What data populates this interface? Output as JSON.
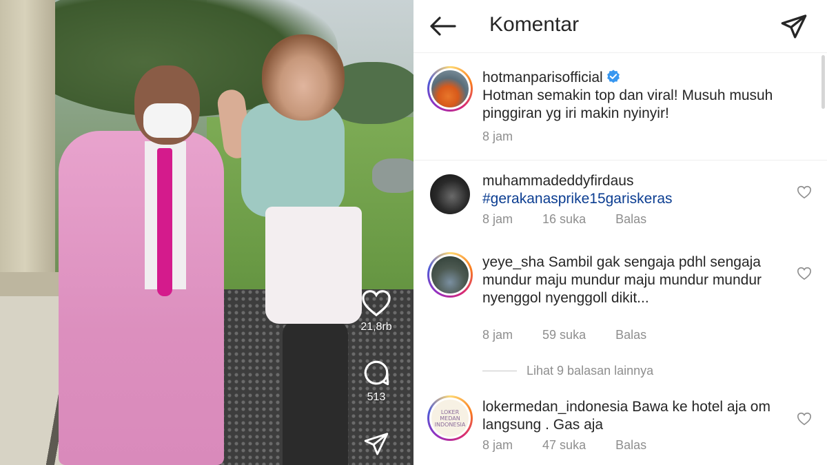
{
  "video": {
    "like_count": "21,8rb",
    "comment_count": "513"
  },
  "header": {
    "title": "Komentar"
  },
  "caption": {
    "username": "hotmanparisofficial",
    "verified": true,
    "text": "Hotman semakin top dan viral! Musuh musuh pinggiran yg iri makin nyinyir!",
    "time": "8 jam"
  },
  "comments": [
    {
      "username": "muhammadeddyfirdaus",
      "text": "#gerakanasprike15gariskeras",
      "time": "8 jam",
      "likes": "16 suka",
      "reply_label": "Balas"
    },
    {
      "username": "yeye_sha",
      "text": "Sambil gak sengaja pdhl sengaja mundur maju mundur maju mundur mundur nyenggol nyenggoll dikit...",
      "time": "8 jam",
      "likes": "59 suka",
      "reply_label": "Balas"
    },
    {
      "username": "lokermedan_indonesia",
      "text": "Bawa ke hotel aja om langsung . Gas aja",
      "time": "8 jam",
      "likes": "47 suka",
      "reply_label": "Balas",
      "avatar_text": [
        "LOKER",
        "MEDAN",
        "INDONESIA"
      ]
    }
  ],
  "view_more_replies": "Lihat 9 balasan lainnya",
  "colors": {
    "hashtag": "#0b3d91",
    "verified": "#3897f0",
    "meta_text": "#8e8e8e"
  },
  "icons": [
    "back-arrow-icon",
    "send-icon",
    "verified-badge-icon",
    "heart-icon",
    "comment-bubble-icon",
    "share-icon"
  ]
}
